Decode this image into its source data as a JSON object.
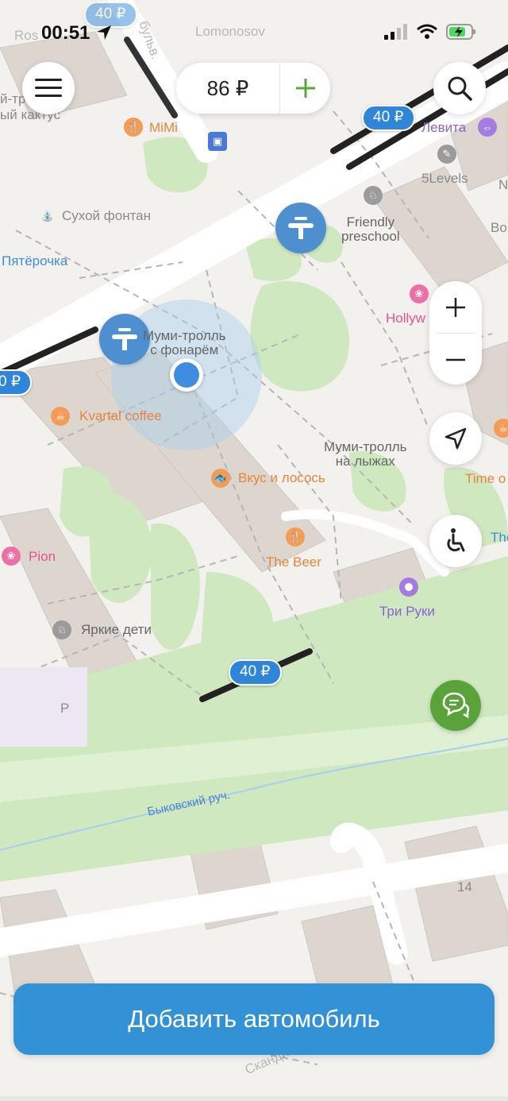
{
  "status_bar": {
    "time": "00:51"
  },
  "top_bar": {
    "balance": "86 ₽",
    "add_balance": "+"
  },
  "map": {
    "labels": {
      "ros": "Ros",
      "lomonosov": "Lomonosov",
      "bulv": "бульв.",
      "troll": "й-тро",
      "kaktus": "ый кактус",
      "mimi": "MiMi",
      "levita": "Левита",
      "fivelevels": "5Levels",
      "n": "N",
      "suhoy": "Сухой фонтан",
      "friendly": "Friendly\npreschool",
      "bo": "Bo",
      "pyaterochka": "Пятёрочка",
      "hollyw": "Hollyw",
      "moomin_lamp": "Муми-тролль\nс фонарём",
      "kvartal": "Kvartal coffee",
      "moomin_ski": "Муми-тролль\nна лыжах",
      "timeo": "Time o",
      "vkus": "Вкус и лосось",
      "the": "The",
      "pion": "Pion",
      "thebeer": "The Beer",
      "triruki": "Три Руки",
      "yarkie": "Яркие дети",
      "p": "P",
      "stream": "Быковский руч.",
      "house14": "14",
      "skandi": "Скандина"
    },
    "price_pins": {
      "top_right": "40 ₽",
      "top_left": "40 ₽",
      "left_edge": "0 ₽",
      "bottom": "40 ₽"
    }
  },
  "colors": {
    "accent": "#3391d6",
    "parking": "#4e8fd0",
    "chat": "#5aa33a",
    "add_plus": "#57a83a"
  },
  "cta": {
    "label": "Добавить автомобиль"
  }
}
